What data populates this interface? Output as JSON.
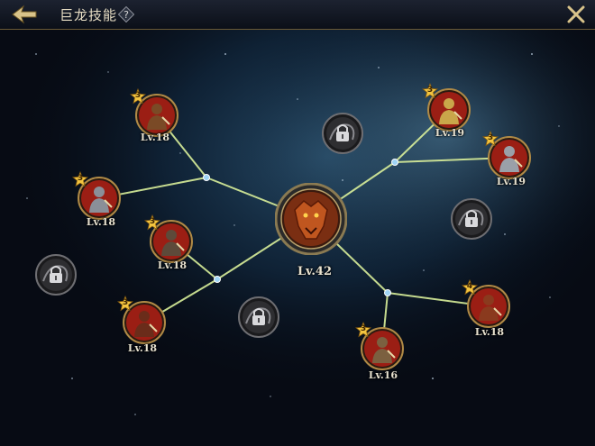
{
  "header": {
    "title": "巨龙技能",
    "help_symbol": "?"
  },
  "colors": {
    "gold": "#c89b3c",
    "line": "#d9ef9a",
    "frame": "#8a7a52",
    "red": "#9b1e14"
  },
  "center_skill": {
    "level_label": "Lv.42",
    "icon": "dragon-head-icon"
  },
  "skills": [
    {
      "id": "top-left",
      "level_label": "Lv.18",
      "rank": "3",
      "icon": "warrior-portrait-icon"
    },
    {
      "id": "left-upper",
      "level_label": "Lv.18",
      "rank": "3",
      "icon": "knight-portrait-icon"
    },
    {
      "id": "left-mid",
      "level_label": "Lv.18",
      "rank": "3",
      "icon": "swordsman-portrait-icon"
    },
    {
      "id": "bottom-left",
      "level_label": "Lv.18",
      "rank": "3",
      "icon": "shield-bearer-portrait-icon"
    },
    {
      "id": "top-right",
      "level_label": "Lv.19",
      "rank": "3",
      "icon": "paladin-portrait-icon"
    },
    {
      "id": "right-upper",
      "level_label": "Lv.19",
      "rank": "3",
      "icon": "armored-knight-portrait-icon"
    },
    {
      "id": "right-lower",
      "level_label": "Lv.18",
      "rank": "4",
      "icon": "crossbowman-portrait-icon"
    },
    {
      "id": "bottom-mid",
      "level_label": "Lv.16",
      "rank": "3",
      "icon": "archer-portrait-icon"
    }
  ],
  "locked_skills": [
    {
      "id": "locked-top",
      "icon": "locked-claw-skill-icon"
    },
    {
      "id": "locked-left",
      "icon": "locked-dragon-coil-skill-icon"
    },
    {
      "id": "locked-bottom",
      "icon": "locked-smoke-skill-icon"
    },
    {
      "id": "locked-right",
      "icon": "locked-scorpion-skill-icon"
    }
  ]
}
